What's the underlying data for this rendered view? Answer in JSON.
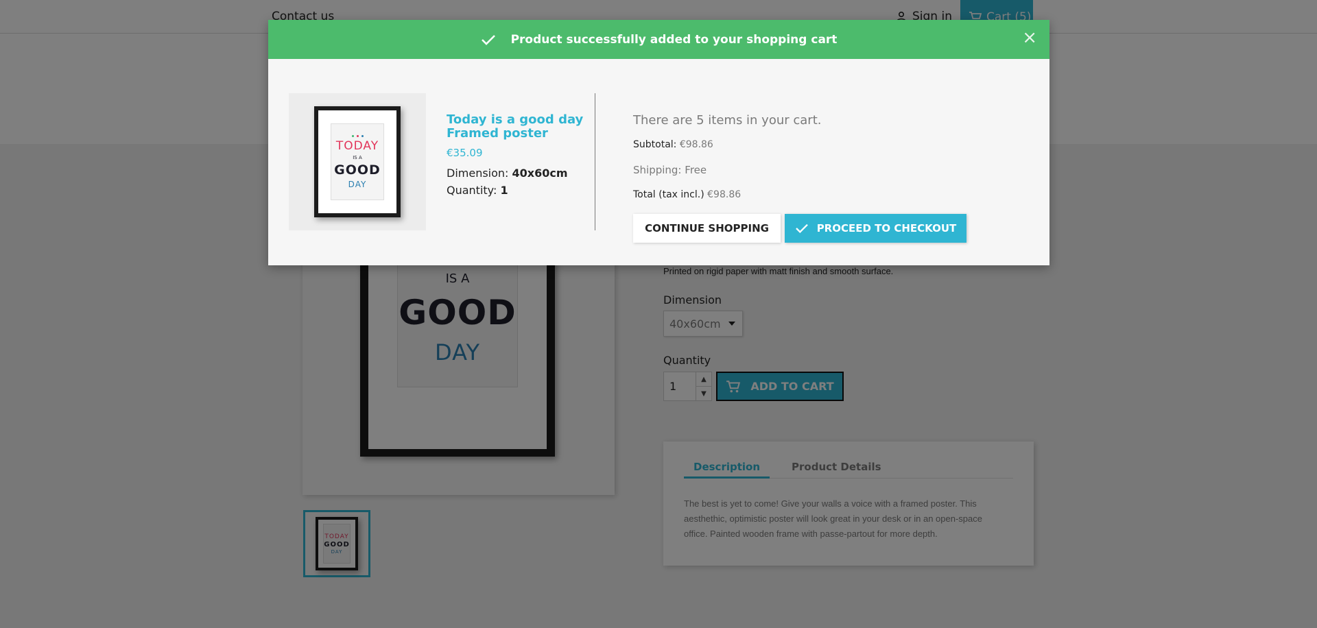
{
  "page": {
    "nav": {
      "contact_label": "Contact us",
      "signin_label": "Sign in",
      "cart_label": "Cart (5)"
    },
    "product": {
      "short_description": "Printed on rigid paper with matt finish and smooth surface.",
      "dimension_label": "Dimension",
      "dimension_value": "40x60cm",
      "quantity_label": "Quantity",
      "quantity_value": "1",
      "add_to_cart_label": "ADD TO CART",
      "poster": {
        "line1": "TODAY",
        "line2": "IS A",
        "line3": "GOOD",
        "line4": "DAY"
      }
    },
    "tabs": {
      "items": [
        {
          "label": "Description"
        },
        {
          "label": "Product Details"
        }
      ],
      "description_text": "The best is yet to come! Give your walls a voice with a framed poster. This aesthethic, optimistic poster will look great in your desk or in an open-space office. Painted wooden frame with passe-partout for more depth."
    }
  },
  "modal": {
    "header_message": "Product successfully added to your shopping cart",
    "close_symbol": "×",
    "product_name": "Today is a good day Framed poster",
    "product_price": "€35.09",
    "attr_label": "Dimension:",
    "attr_value": "40x60cm",
    "qty_label": "Quantity:",
    "qty_value": "1",
    "cart_count_text": "There are 5 items in your cart.",
    "subtotal_label": "Subtotal:",
    "subtotal_value": "€98.86",
    "shipping_label": "Shipping:",
    "shipping_value": "Free",
    "total_label": "Total (tax incl.)",
    "total_value": "€98.86",
    "continue_label": "CONTINUE SHOPPING",
    "checkout_label": "PROCEED TO CHECKOUT"
  },
  "colors": {
    "accent": "#2fb5d2",
    "success": "#4cbb6c",
    "overlay": "rgba(0,0,0,0.5)"
  },
  "icons": [
    "person-icon",
    "cart-icon",
    "check-icon",
    "close-icon",
    "caret-down-icon",
    "spin-up-icon",
    "spin-down-icon"
  ]
}
